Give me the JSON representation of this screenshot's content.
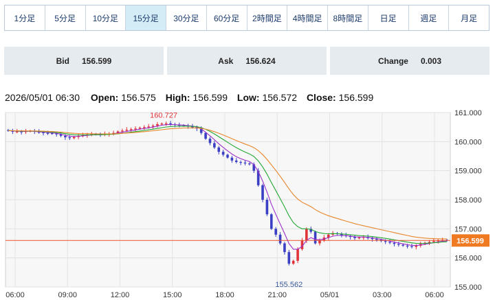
{
  "timeframes": {
    "items": [
      "1分足",
      "5分足",
      "10分足",
      "15分足",
      "30分足",
      "60分足",
      "2時間足",
      "4時間足",
      "8時間足",
      "日足",
      "週足",
      "月足"
    ],
    "active_index": 3
  },
  "quotes": {
    "bid_label": "Bid",
    "bid_value": "156.599",
    "ask_label": "Ask",
    "ask_value": "156.624",
    "change_label": "Change",
    "change_value": "0.003"
  },
  "ohlc": {
    "timestamp": "2026/05/01 06:30",
    "open_label": "Open:",
    "open": "156.575",
    "high_label": "High:",
    "high": "156.599",
    "low_label": "Low:",
    "low": "156.572",
    "close_label": "Close:",
    "close": "156.599"
  },
  "chart_data": {
    "type": "candlestick",
    "ylim": [
      155.0,
      161.0
    ],
    "y_ticks": [
      "161.000",
      "160.000",
      "159.000",
      "158.000",
      "157.000",
      "156.000",
      "155.000"
    ],
    "x_ticks": [
      "06:00",
      "09:00",
      "12:00",
      "15:00",
      "18:00",
      "21:00",
      "05/01",
      "03:00",
      "06:00"
    ],
    "current_price": 156.599,
    "current_price_label": "156.599",
    "annotations": {
      "max": 160.727,
      "max_label": "160.727",
      "min": 155.562,
      "min_label": "155.562"
    },
    "colors": {
      "up": "#e0343a",
      "down": "#3b3fc4",
      "ma_fast": "#9a2fc9",
      "ma_mid": "#22a833",
      "ma_slow": "#e8862a",
      "price_line": "#e8542a",
      "price_tag": "#f07a22",
      "max_label": "#e0343a",
      "min_label": "#3a5a9a"
    },
    "closes": [
      160.38,
      160.34,
      160.35,
      160.33,
      160.36,
      160.37,
      160.34,
      160.32,
      160.3,
      160.29,
      160.28,
      160.25,
      160.2,
      160.15,
      160.12,
      160.16,
      160.2,
      160.22,
      160.25,
      160.26,
      160.25,
      160.24,
      160.26,
      160.28,
      160.3,
      160.35,
      160.38,
      160.41,
      160.43,
      160.45,
      160.48,
      160.5,
      160.52,
      160.55,
      160.6,
      160.62,
      160.63,
      160.6,
      160.58,
      160.56,
      160.55,
      160.52,
      160.5,
      160.45,
      160.3,
      160.1,
      159.95,
      159.8,
      159.65,
      159.55,
      159.45,
      159.35,
      159.3,
      159.28,
      159.25,
      159.22,
      159.0,
      158.5,
      158.0,
      157.5,
      157.0,
      156.8,
      156.5,
      156.2,
      155.8,
      155.9,
      156.3,
      156.6,
      157.0,
      156.9,
      156.5,
      156.6,
      156.7,
      156.8,
      156.85,
      156.82,
      156.78,
      156.75,
      156.72,
      156.68,
      156.7,
      156.72,
      156.68,
      156.65,
      156.62,
      156.58,
      156.55,
      156.52,
      156.48,
      156.45,
      156.42,
      156.4,
      156.38,
      156.42,
      156.48,
      156.52,
      156.55,
      156.58,
      156.6,
      156.62,
      156.6
    ]
  }
}
